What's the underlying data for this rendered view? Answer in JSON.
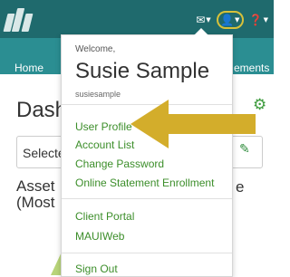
{
  "header": {
    "logo_icon": "illi-logo",
    "mail_icon": "envelope-icon",
    "user_icon": "person-icon",
    "help_icon": "question-icon",
    "accent_color": "#d7c13a",
    "bar_color": "#1f6a6d"
  },
  "nav": {
    "home_label": "Home",
    "right_label": "ements",
    "bar_color": "#2b8e92"
  },
  "main": {
    "title": "Dash",
    "select_label": "Selecte",
    "asset_title": "Asset\n(Most",
    "trailing_letter": "e"
  },
  "user_menu": {
    "welcome": "Welcome,",
    "name": "Susie Sample",
    "username": "susiesample",
    "items": [
      {
        "label": "User Profile"
      },
      {
        "label": "Account List"
      },
      {
        "label": "Change Password"
      },
      {
        "label": "Online Statement Enrollment"
      },
      {
        "label": "Client Portal"
      },
      {
        "label": "MAUIWeb"
      },
      {
        "label": "Sign Out"
      }
    ],
    "link_color": "#3c8e2a"
  },
  "annotation": {
    "arrow_color": "#d3ad2b"
  }
}
